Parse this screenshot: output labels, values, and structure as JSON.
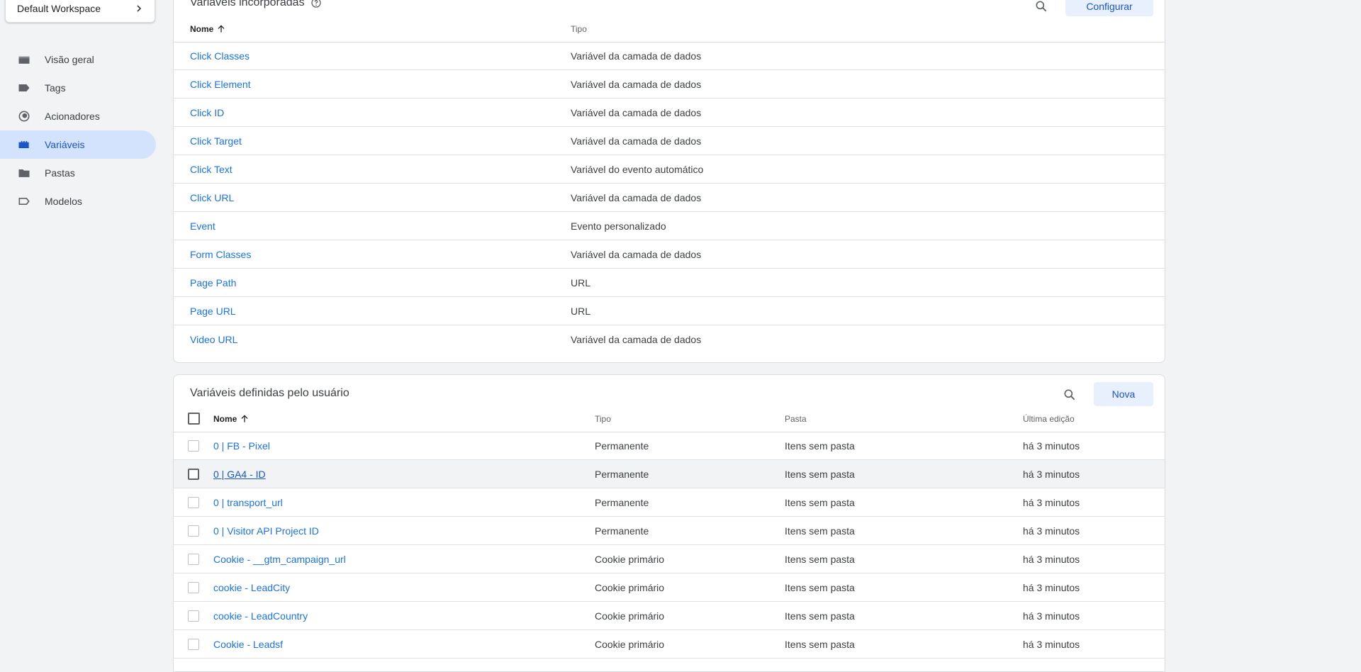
{
  "sidebar": {
    "workspace": "Default Workspace",
    "items": [
      {
        "label": "Visão geral",
        "icon": "briefcase-icon"
      },
      {
        "label": "Tags",
        "icon": "tag-icon"
      },
      {
        "label": "Acionadores",
        "icon": "trigger-icon"
      },
      {
        "label": "Variáveis",
        "icon": "variables-icon",
        "active": true
      },
      {
        "label": "Pastas",
        "icon": "folder-icon"
      },
      {
        "label": "Modelos",
        "icon": "template-icon"
      }
    ]
  },
  "builtin": {
    "title": "Variáveis incorporadas",
    "configure_label": "Configurar",
    "col_name": "Nome",
    "col_type": "Tipo",
    "rows": [
      {
        "name": "Click Classes",
        "type": "Variável da camada de dados"
      },
      {
        "name": "Click Element",
        "type": "Variável da camada de dados"
      },
      {
        "name": "Click ID",
        "type": "Variável da camada de dados"
      },
      {
        "name": "Click Target",
        "type": "Variável da camada de dados"
      },
      {
        "name": "Click Text",
        "type": "Variável do evento automático"
      },
      {
        "name": "Click URL",
        "type": "Variável da camada de dados"
      },
      {
        "name": "Event",
        "type": "Evento personalizado"
      },
      {
        "name": "Form Classes",
        "type": "Variável da camada de dados"
      },
      {
        "name": "Page Path",
        "type": "URL"
      },
      {
        "name": "Page URL",
        "type": "URL"
      },
      {
        "name": "Video URL",
        "type": "Variável da camada de dados"
      }
    ]
  },
  "user": {
    "title": "Variáveis definidas pelo usuário",
    "new_label": "Nova",
    "col_name": "Nome",
    "col_type": "Tipo",
    "col_folder": "Pasta",
    "col_edit": "Última edição",
    "rows": [
      {
        "name": "0 | FB - Pixel",
        "type": "Permanente",
        "folder": "Itens sem pasta",
        "edited": "há 3 minutos"
      },
      {
        "name": "0 | GA4 - ID",
        "type": "Permanente",
        "folder": "Itens sem pasta",
        "edited": "há 3 minutos",
        "hover": true
      },
      {
        "name": "0 | transport_url",
        "type": "Permanente",
        "folder": "Itens sem pasta",
        "edited": "há 3 minutos"
      },
      {
        "name": "0 | Visitor API Project ID",
        "type": "Permanente",
        "folder": "Itens sem pasta",
        "edited": "há 3 minutos"
      },
      {
        "name": "Cookie - __gtm_campaign_url",
        "type": "Cookie primário",
        "folder": "Itens sem pasta",
        "edited": "há 3 minutos"
      },
      {
        "name": "cookie - LeadCity",
        "type": "Cookie primário",
        "folder": "Itens sem pasta",
        "edited": "há 3 minutos"
      },
      {
        "name": "cookie - LeadCountry",
        "type": "Cookie primário",
        "folder": "Itens sem pasta",
        "edited": "há 3 minutos"
      },
      {
        "name": "Cookie - Leadsf",
        "type": "Cookie primário",
        "folder": "Itens sem pasta",
        "edited": "há 3 minutos"
      }
    ]
  }
}
